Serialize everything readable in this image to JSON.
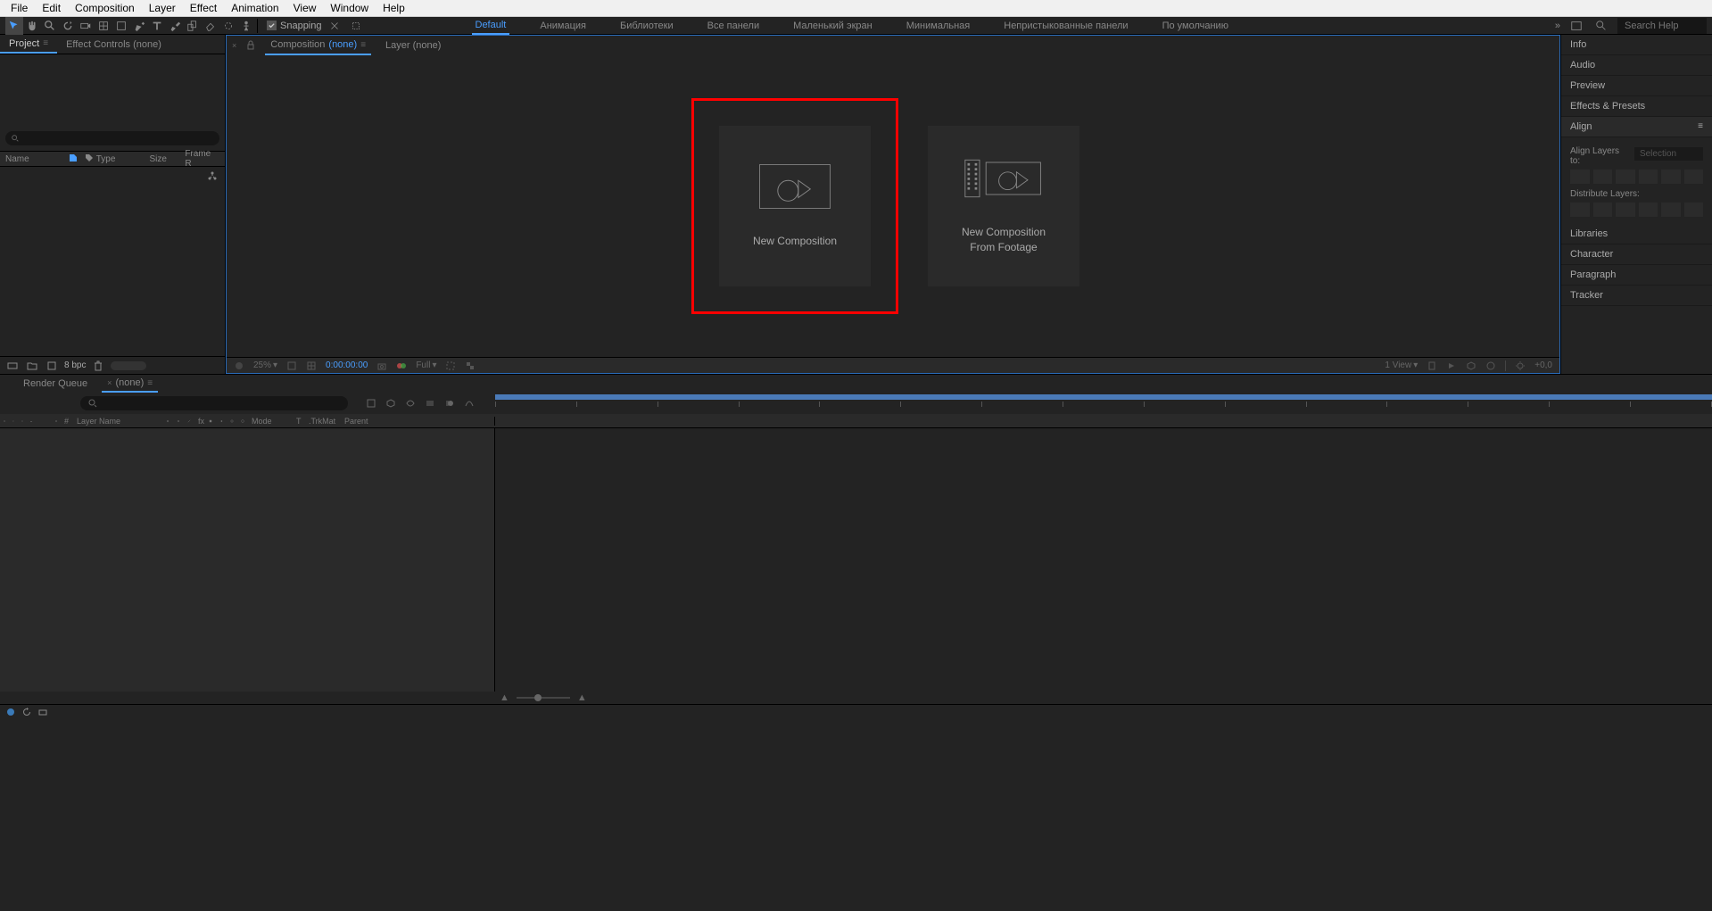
{
  "menubar": [
    "File",
    "Edit",
    "Composition",
    "Layer",
    "Effect",
    "Animation",
    "View",
    "Window",
    "Help"
  ],
  "toolbar": {
    "snapping_label": "Snapping"
  },
  "workspaces": {
    "items": [
      "Default",
      "Анимация",
      "Библиотеки",
      "Все панели",
      "Маленький экран",
      "Минимальная",
      "Непристыкованные панели",
      "По умолчанию"
    ],
    "search_placeholder": "Search Help"
  },
  "left_panel": {
    "tabs": {
      "project": "Project",
      "effect_controls": "Effect Controls (none)"
    },
    "columns": {
      "name": "Name",
      "type": "Type",
      "size": "Size",
      "frame": "Frame R"
    }
  },
  "center": {
    "tabs": {
      "composition_prefix": "Composition",
      "composition_none": "(none)",
      "layer": "Layer (none)"
    },
    "cards": {
      "new_comp": "New Composition",
      "new_comp_footage_l1": "New Composition",
      "new_comp_footage_l2": "From Footage"
    },
    "viewer": {
      "zoom": "25%",
      "time": "0:00:00:00",
      "resolution": "Full",
      "views": "1 View",
      "exposure": "+0,0"
    }
  },
  "right_panel": {
    "sections": [
      "Info",
      "Audio",
      "Preview",
      "Effects & Presets",
      "Align",
      "Libraries",
      "Character",
      "Paragraph",
      "Tracker"
    ],
    "align": {
      "layers_to": "Align Layers to:",
      "selection": "Selection",
      "distribute": "Distribute Layers:"
    }
  },
  "proj_bottom": {
    "bpc": "8 bpc"
  },
  "timeline": {
    "tabs": {
      "render_queue": "Render Queue",
      "none": "(none)"
    },
    "header": {
      "layer_name": "Layer Name",
      "mode": "Mode",
      "t": "T",
      "trkmat": ".TrkMat",
      "parent": "Parent"
    }
  }
}
